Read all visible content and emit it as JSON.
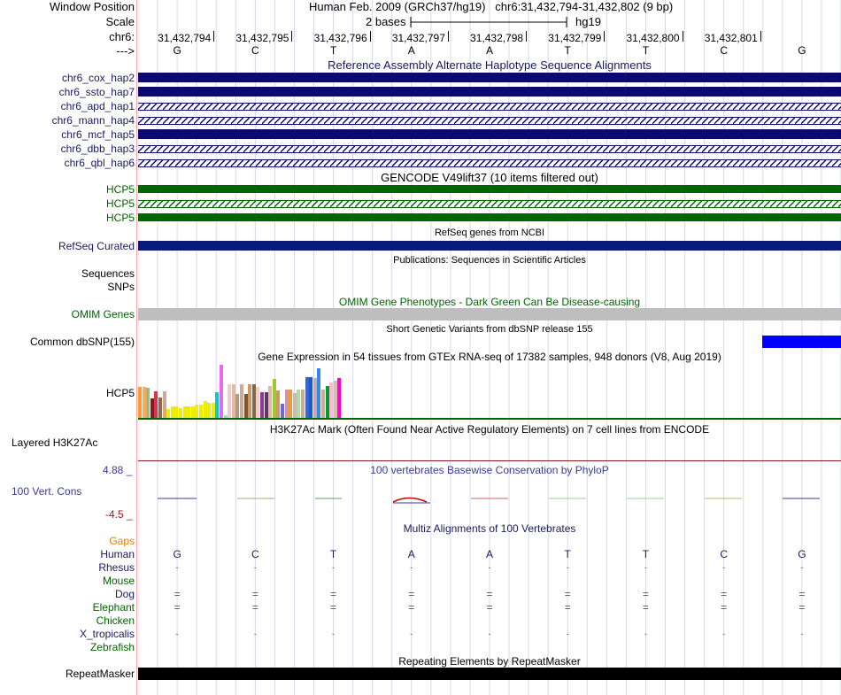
{
  "colors": {
    "navy": "#0a0a70",
    "dark_green": "#006400",
    "refseq_blue": "#0a1a7a",
    "omim_gray": "#bebebe",
    "snp_blue": "#0000ff",
    "label_navy": "#1a1a5e",
    "phylop_blue": "#3a3a9c",
    "phylop_red": "#8b1a1a",
    "gaps_orange": "#e08000"
  },
  "header": {
    "window_position_label": "Window Position",
    "scale_label": "Scale",
    "chr_label": "chr6:",
    "arrow_label": "--->",
    "assembly": "Human Feb. 2009 (GRCh37/hg19)",
    "position": "chr6:31,432,794-31,432,802 (9 bp)",
    "scale_text": "2 bases",
    "db": "hg19",
    "coords": [
      "31,432,794",
      "31,432,795",
      "31,432,796",
      "31,432,797",
      "31,432,798",
      "31,432,799",
      "31,432,800",
      "31,432,801"
    ],
    "bases": [
      "G",
      "C",
      "T",
      "A",
      "A",
      "T",
      "T",
      "C",
      "G"
    ]
  },
  "alt_haplotypes": {
    "title": "Reference Assembly Alternate Haplotype Sequence Alignments",
    "tracks": [
      {
        "label": "chr6_cox_hap2",
        "style": "solid"
      },
      {
        "label": "chr6_ssto_hap7",
        "style": "solid"
      },
      {
        "label": "chr6_apd_hap1",
        "style": "dashed"
      },
      {
        "label": "chr6_mann_hap4",
        "style": "dashed"
      },
      {
        "label": "chr6_mcf_hap5",
        "style": "solid"
      },
      {
        "label": "chr6_dbb_hap3",
        "style": "dashed"
      },
      {
        "label": "chr6_qbl_hap6",
        "style": "dashed"
      }
    ]
  },
  "gencode": {
    "title": "GENCODE V49lift37 (10 items filtered out)",
    "tracks": [
      {
        "label": "HCP5",
        "style": "solid"
      },
      {
        "label": "HCP5",
        "style": "dashed"
      },
      {
        "label": "HCP5",
        "style": "solid"
      }
    ]
  },
  "refseq": {
    "title": "RefSeq genes from NCBI",
    "label": "RefSeq Curated"
  },
  "publications": {
    "title": "Publications: Sequences in Scientific Articles",
    "sequences_label": "Sequences",
    "snps_label": "SNPs"
  },
  "omim": {
    "title": "OMIM Gene Phenotypes - Dark Green Can Be Disease-causing",
    "label": "OMIM Genes"
  },
  "dbsnp": {
    "title": "Short Genetic Variants from dbSNP release 155",
    "label": "Common dbSNP(155)"
  },
  "gtex": {
    "title": "Gene Expression in 54 tissues from GTEx RNA-seq of 17382 samples, 948 donors (V8, Aug 2019)",
    "label": "HCP5",
    "bars": [
      {
        "c": "#ff9933",
        "v": 0.59
      },
      {
        "c": "#ffaa55",
        "v": 0.59
      },
      {
        "c": "#99bb88",
        "v": 0.57
      },
      {
        "c": "#7a1f2a",
        "v": 0.37
      },
      {
        "c": "#dd3344",
        "v": 0.5
      },
      {
        "c": "#996644",
        "v": 0.38
      },
      {
        "c": "#ccaa99",
        "v": 0.5
      },
      {
        "c": "#eeee00",
        "v": 0.16
      },
      {
        "c": "#eeee00",
        "v": 0.22
      },
      {
        "c": "#eeee00",
        "v": 0.22
      },
      {
        "c": "#eeee00",
        "v": 0.19
      },
      {
        "c": "#eeee00",
        "v": 0.22
      },
      {
        "c": "#eeee00",
        "v": 0.22
      },
      {
        "c": "#eeee00",
        "v": 0.22
      },
      {
        "c": "#eeee00",
        "v": 0.25
      },
      {
        "c": "#eeee00",
        "v": 0.25
      },
      {
        "c": "#eeee00",
        "v": 0.32
      },
      {
        "c": "#eeee00",
        "v": 0.29
      },
      {
        "c": "#eeee00",
        "v": 0.29
      },
      {
        "c": "#00cccc",
        "v": 0.48
      },
      {
        "c": "#ee66ee",
        "v": 1.0
      },
      {
        "c": "#99ccff",
        "v": 0.05
      },
      {
        "c": "#eecccc",
        "v": 0.63
      },
      {
        "c": "#ddbbaa",
        "v": 0.63
      },
      {
        "c": "#bb9977",
        "v": 0.45
      },
      {
        "c": "#ccaa99",
        "v": 0.63
      },
      {
        "c": "#775533",
        "v": 0.45
      },
      {
        "c": "#cc9966",
        "v": 0.63
      },
      {
        "c": "#886644",
        "v": 0.63
      },
      {
        "c": "#eecccc",
        "v": 0.58
      },
      {
        "c": "#993399",
        "v": 0.48
      },
      {
        "c": "#663366",
        "v": 0.48
      },
      {
        "c": "#ddbbaa",
        "v": 0.6
      },
      {
        "c": "#99cc33",
        "v": 0.74
      },
      {
        "c": "#cc9966",
        "v": 0.52
      },
      {
        "c": "#6666ee",
        "v": 0.27
      },
      {
        "c": "#cc99aa",
        "v": 0.53
      },
      {
        "c": "#ee9933",
        "v": 0.53
      },
      {
        "c": "#ccbbaa",
        "v": 0.47
      },
      {
        "c": "#aaddaa",
        "v": 0.53
      },
      {
        "c": "#ccaa99",
        "v": 0.53
      },
      {
        "c": "#3366dd",
        "v": 0.77
      },
      {
        "c": "#2255cc",
        "v": 0.77
      },
      {
        "c": "#ccaa99",
        "v": 0.75
      },
      {
        "c": "#3388ee",
        "v": 0.93
      },
      {
        "c": "#ccaa99",
        "v": 0.53
      },
      {
        "c": "#009933",
        "v": 0.6
      },
      {
        "c": "#ffbbcc",
        "v": 0.67
      },
      {
        "c": "#ddbbaa",
        "v": 0.7
      },
      {
        "c": "#ff00dd",
        "v": 0.75
      }
    ]
  },
  "h3k27ac": {
    "title": "H3K27Ac Mark (Often Found Near Active Regulatory Elements) on 7 cell lines from ENCODE",
    "label": "Layered H3K27Ac"
  },
  "phylop": {
    "title": "100 vertebrates Basewise Conservation by PhyloP",
    "label": "100 Vert. Cons",
    "max_label": "4.88 _",
    "min_label": "-4.5 _"
  },
  "multiz": {
    "title": "Multiz Alignments of 100 Vertebrates",
    "gaps_label": "Gaps",
    "species": [
      {
        "name": "Human",
        "color": "#1a1a5e",
        "seq": [
          "G",
          "C",
          "T",
          "A",
          "A",
          "T",
          "T",
          "C",
          "G"
        ]
      },
      {
        "name": "Rhesus",
        "color": "#1a1a5e",
        "seq": [
          "-",
          "-",
          "-",
          "-",
          "-",
          "-",
          "-",
          "-",
          "-"
        ]
      },
      {
        "name": "Mouse",
        "color": "#006400",
        "seq": [
          "",
          "",
          "",
          "",
          "",
          "",
          "",
          "",
          ""
        ]
      },
      {
        "name": "Dog",
        "color": "#1a1a5e",
        "seq": [
          "=",
          "=",
          "=",
          "=",
          "=",
          "=",
          "=",
          "=",
          "="
        ]
      },
      {
        "name": "Elephant",
        "color": "#006400",
        "seq": [
          "=",
          "=",
          "=",
          "=",
          "=",
          "=",
          "=",
          "=",
          "="
        ]
      },
      {
        "name": "Chicken",
        "color": "#006400",
        "seq": [
          "",
          "",
          "",
          "",
          "",
          "",
          "",
          "",
          ""
        ]
      },
      {
        "name": "X_tropicalis",
        "color": "#1a1a5e",
        "seq": [
          "-",
          "-",
          "-",
          "-",
          "-",
          "-",
          "-",
          "-",
          "-"
        ]
      },
      {
        "name": "Zebrafish",
        "color": "#006400",
        "seq": [
          "",
          "",
          "",
          "",
          "",
          "",
          "",
          "",
          ""
        ]
      }
    ]
  },
  "repeatmasker": {
    "title": "Repeating Elements by RepeatMasker",
    "label": "RepeatMasker"
  }
}
